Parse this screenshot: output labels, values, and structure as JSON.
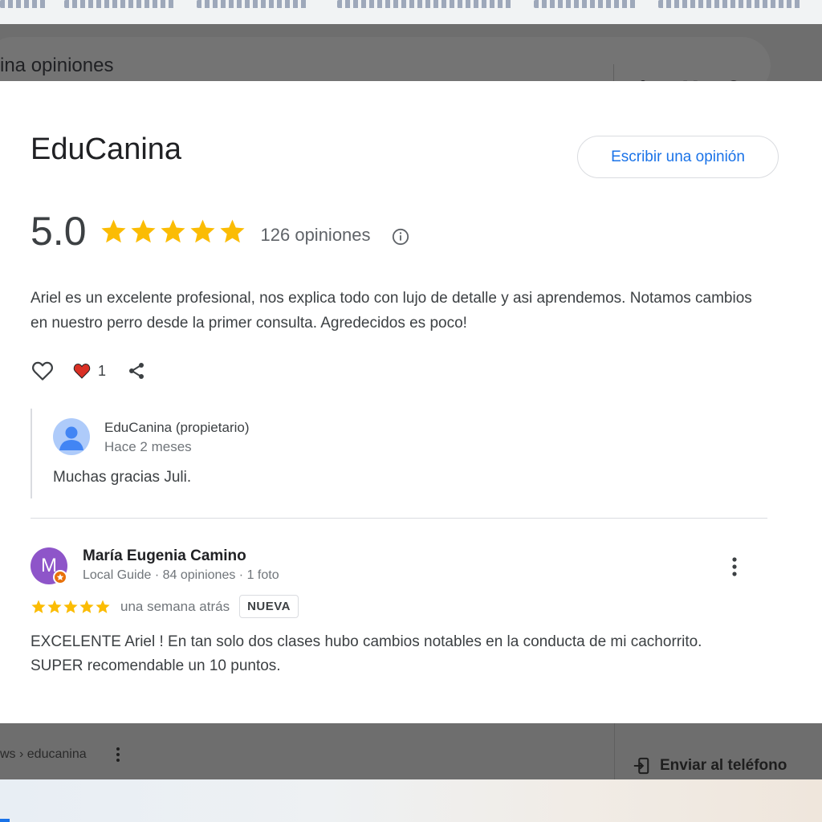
{
  "search": {
    "query": "ina opiniones",
    "icons": [
      "close-icon",
      "microphone-icon",
      "lens-icon",
      "search-icon"
    ]
  },
  "business": {
    "name": "EduCanina",
    "write_review_label": "Escribir una opinión",
    "rating": "5.0",
    "review_count": "126 opiniones",
    "stars": 5
  },
  "review1": {
    "text": "Ariel es un excelente profesional, nos explica todo con lujo de detalle y asi aprendemos. Notamos cambios en nuestro perro desde la primer consulta. Agredecidos es poco!",
    "like_count": "1"
  },
  "owner_reply": {
    "name": "EduCanina (propietario)",
    "time": "Hace 2 meses",
    "text": "Muchas gracias Juli."
  },
  "review2": {
    "avatar_letter": "M",
    "author": "María Eugenia Camino",
    "meta": "Local Guide · 84 opiniones · 1 foto",
    "stars": 5,
    "time": "una semana atrás",
    "badge": "NUEVA",
    "text": "EXCELENTE Ariel ! En tan solo dos clases hubo cambios notables en la conducta de mi cachorrito. SUPER recomendable un 10 puntos."
  },
  "footer": {
    "breadcrumb": "ws › educanina",
    "send_to_phone": "Enviar al teléfono"
  },
  "colors": {
    "star": "#fbbc04",
    "link_blue": "#1a73e8",
    "heart_red": "#d93025",
    "avatar_purple": "#8e55c9"
  }
}
